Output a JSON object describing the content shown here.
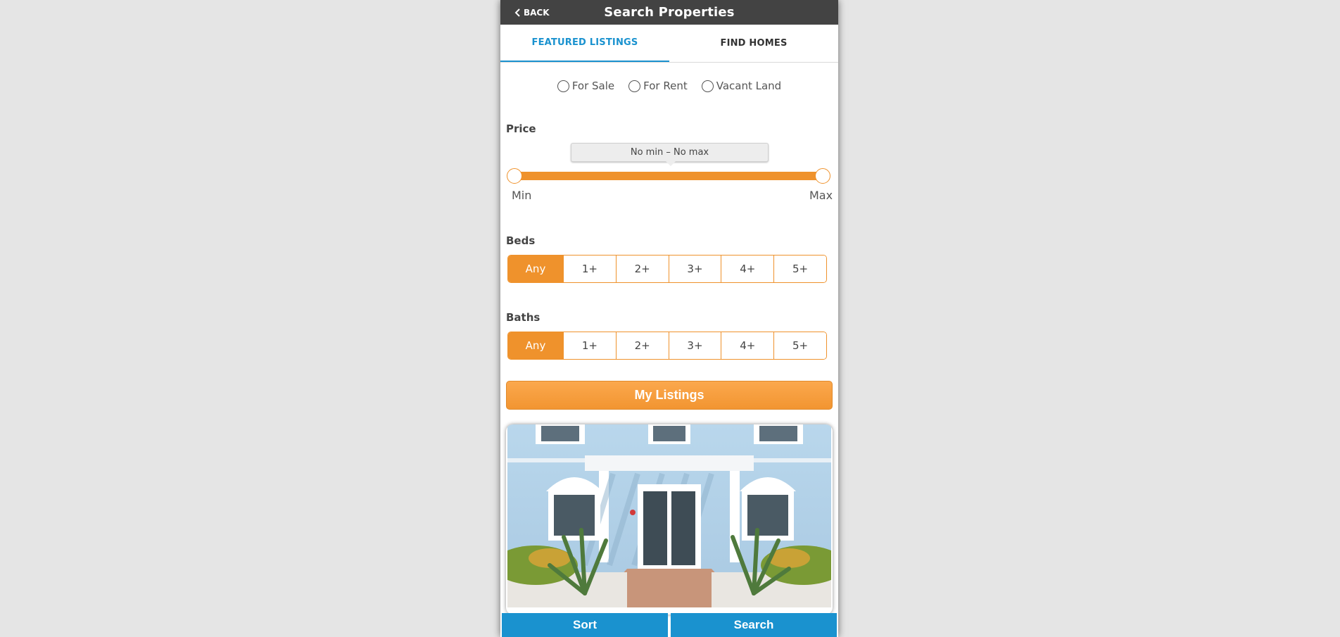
{
  "header": {
    "back_label": "BACK",
    "title": "Search Properties"
  },
  "tabs": [
    {
      "label": "FEATURED LISTINGS",
      "active": true
    },
    {
      "label": "FIND HOMES",
      "active": false
    }
  ],
  "listing_types": [
    {
      "label": "For Sale",
      "checked": false
    },
    {
      "label": "For Rent",
      "checked": false
    },
    {
      "label": "Vacant Land",
      "checked": false
    }
  ],
  "price": {
    "label": "Price",
    "range_text": "No min – No max",
    "min_label": "Min",
    "max_label": "Max"
  },
  "beds": {
    "label": "Beds",
    "options": [
      "Any",
      "1+",
      "2+",
      "3+",
      "4+",
      "5+"
    ],
    "selected": "Any"
  },
  "baths": {
    "label": "Baths",
    "options": [
      "Any",
      "1+",
      "2+",
      "3+",
      "4+",
      "5+"
    ],
    "selected": "Any"
  },
  "my_listings_label": "My Listings",
  "bottom": {
    "sort_label": "Sort",
    "search_label": "Search"
  },
  "colors": {
    "accent_orange": "#ef922c",
    "accent_blue": "#1a92cf",
    "header_bg": "#434343"
  }
}
